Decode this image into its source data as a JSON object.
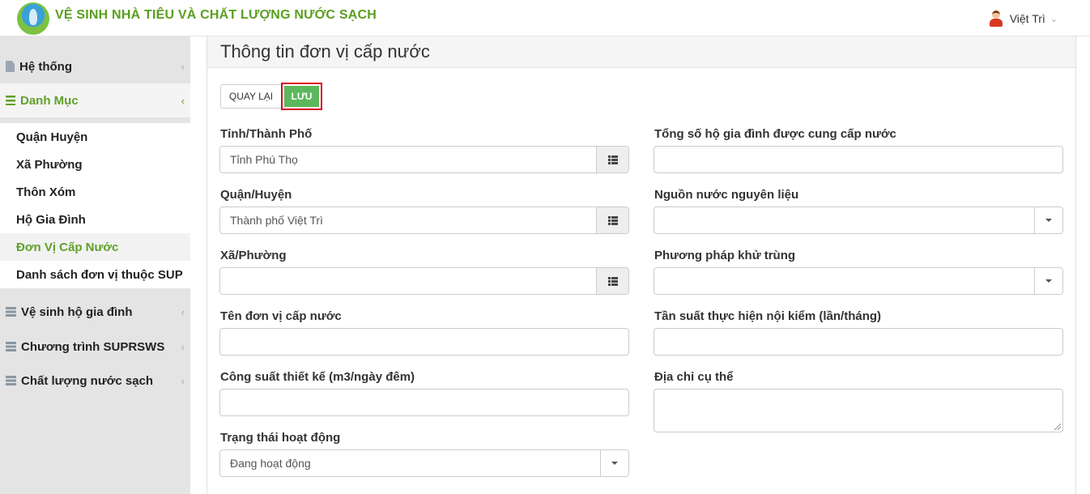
{
  "header": {
    "app_title": "VỆ SINH NHÀ TIÊU VÀ CHẤT LƯỢNG NƯỚC SẠCH",
    "user_name": "Việt Trì"
  },
  "sidebar": {
    "items": [
      {
        "label": "Hệ thống"
      },
      {
        "label": "Danh Mục"
      },
      {
        "label": "Vệ sinh hộ gia đình"
      },
      {
        "label": "Chương trình SUPRSWS"
      },
      {
        "label": "Chất lượng nước sạch"
      }
    ],
    "submenu": [
      {
        "label": "Quận Huyện"
      },
      {
        "label": "Xã Phường"
      },
      {
        "label": "Thôn Xóm"
      },
      {
        "label": "Hộ Gia Đình"
      },
      {
        "label": "Đơn Vị Cấp Nước"
      },
      {
        "label": "Danh sách đơn vị thuộc SUP"
      }
    ]
  },
  "panel": {
    "title": "Thông tin đơn vị cấp nước",
    "back_label": "QUAY LẠI",
    "save_label": "LƯU"
  },
  "form": {
    "province": {
      "label": "Tỉnh/Thành Phố",
      "value": "Tỉnh Phú Thọ"
    },
    "district": {
      "label": "Quận/Huyện",
      "value": "Thành phố Việt Trì"
    },
    "ward": {
      "label": "Xã/Phường",
      "value": ""
    },
    "unit_name": {
      "label": "Tên đơn vị cấp nước",
      "value": ""
    },
    "capacity": {
      "label": "Công suất thiết kế (m3/ngày đêm)",
      "value": ""
    },
    "status": {
      "label": "Trạng thái hoạt động",
      "value": "Đang hoạt động"
    },
    "households": {
      "label": "Tổng số hộ gia đình được cung cấp nước",
      "value": ""
    },
    "water_source": {
      "label": "Nguồn nước nguyên liệu",
      "value": ""
    },
    "disinfection": {
      "label": "Phương pháp khử trùng",
      "value": ""
    },
    "inspection_freq": {
      "label": "Tần suất thực hiện nội kiểm (lần/tháng)",
      "value": ""
    },
    "address": {
      "label": "Địa chỉ cụ thể",
      "value": ""
    }
  }
}
